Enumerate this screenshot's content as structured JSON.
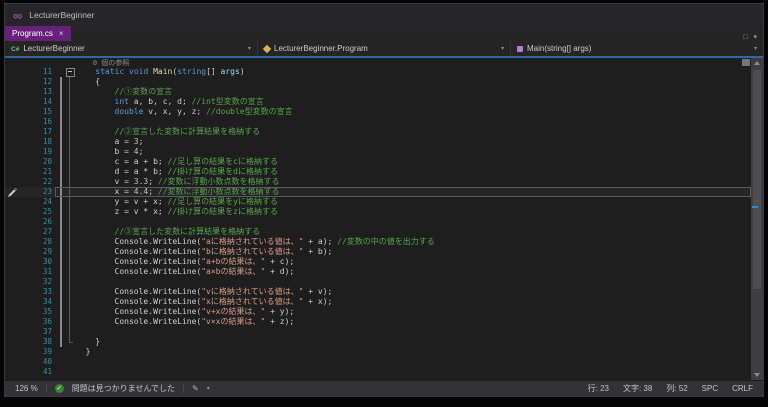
{
  "window": {
    "title": "LecturerBeginner"
  },
  "icons": {
    "logo": "∞",
    "close": "×",
    "chevron_down": "▾",
    "window_box": "□",
    "check": "✓",
    "pencil": "✎",
    "csharp": "C#"
  },
  "colors": {
    "titlebar_bg": "#26262A",
    "tabbar_bg": "#252526",
    "tab_accent": "#68217A",
    "nav_underline": "#2D68A8",
    "editor_bg": "#1E1E1E",
    "statusbar_bg": "#323237",
    "line_number": "#2B91AF",
    "keyword": "#569CD6",
    "comment": "#57A64A",
    "string": "#D69D85",
    "number": "#B5CEA8",
    "method": "#DCDCAA",
    "parameter": "#9CDCFE",
    "plain": "#CFCFCF",
    "codelens": "#8C8C8C",
    "change_bar": "#8A8A8A",
    "current_line_border": "#5A5A60"
  },
  "tab_bar": {
    "tabs": [
      {
        "label": "Program.cs"
      }
    ]
  },
  "navbar": {
    "project": "LecturerBeginner",
    "type": "LecturerBeginner.Program",
    "member": "Main(string[] args)"
  },
  "editor": {
    "lines": [
      {
        "lens": true,
        "tokens": [
          [
            "lens",
            "    0 個の参照"
          ]
        ]
      },
      {
        "num": 11,
        "fold": "box",
        "tokens": [
          [
            "kw",
            "    static"
          ],
          [
            "pl",
            " "
          ],
          [
            "kw",
            "void"
          ],
          [
            "pl",
            " "
          ],
          [
            "fn",
            "Main"
          ],
          [
            "pl",
            "("
          ],
          [
            "kw",
            "string"
          ],
          [
            "pl",
            "[] "
          ],
          [
            "pm",
            "args"
          ],
          [
            "pl",
            ")"
          ]
        ]
      },
      {
        "num": 12,
        "fold": "line",
        "chg": true,
        "tokens": [
          [
            "pl",
            "    {"
          ]
        ]
      },
      {
        "num": 13,
        "fold": "line",
        "chg": true,
        "tokens": [
          [
            "cm",
            "        //①変数の宣言"
          ]
        ]
      },
      {
        "num": 14,
        "fold": "line",
        "chg": true,
        "tokens": [
          [
            "kw",
            "        int"
          ],
          [
            "pl",
            " a, b, c, d; "
          ],
          [
            "cm",
            "//int型変数の宣言"
          ]
        ]
      },
      {
        "num": 15,
        "fold": "line",
        "chg": true,
        "tokens": [
          [
            "kw",
            "        double"
          ],
          [
            "pl",
            " v, x, y, z; "
          ],
          [
            "cm",
            "//double型変数の宣言"
          ]
        ]
      },
      {
        "num": 16,
        "fold": "line",
        "chg": true,
        "tokens": []
      },
      {
        "num": 17,
        "fold": "line",
        "chg": true,
        "tokens": [
          [
            "cm",
            "        //②宣言した変数に計算結果を格納する"
          ]
        ]
      },
      {
        "num": 18,
        "fold": "line",
        "chg": true,
        "tokens": [
          [
            "pl",
            "        a = "
          ],
          [
            "num",
            "3"
          ],
          [
            "pl",
            ";"
          ]
        ]
      },
      {
        "num": 19,
        "fold": "line",
        "chg": true,
        "tokens": [
          [
            "pl",
            "        b = "
          ],
          [
            "num",
            "4"
          ],
          [
            "pl",
            ";"
          ]
        ]
      },
      {
        "num": 20,
        "fold": "line",
        "chg": true,
        "tokens": [
          [
            "pl",
            "        c = a + b; "
          ],
          [
            "cm",
            "//足し算の結果をcに格納する"
          ]
        ]
      },
      {
        "num": 21,
        "fold": "line",
        "chg": true,
        "tokens": [
          [
            "pl",
            "        d = a * b; "
          ],
          [
            "cm",
            "//掛け算の結果をdに格納する"
          ]
        ]
      },
      {
        "num": 22,
        "fold": "line",
        "chg": true,
        "tokens": [
          [
            "pl",
            "        v = "
          ],
          [
            "num",
            "3.3"
          ],
          [
            "pl",
            "; "
          ],
          [
            "cm",
            "//変数に浮動小数点数を格納する"
          ]
        ]
      },
      {
        "num": 23,
        "fold": "line",
        "chg": true,
        "current": true,
        "pencil": true,
        "tokens": [
          [
            "pl",
            "        x = "
          ],
          [
            "num",
            "4.4"
          ],
          [
            "pl",
            "; "
          ],
          [
            "cm",
            "//変数に浮動小数点数を格納する"
          ]
        ]
      },
      {
        "num": 24,
        "fold": "line",
        "chg": true,
        "tokens": [
          [
            "pl",
            "        y = v + x; "
          ],
          [
            "cm",
            "//足し算の結果をyに格納する"
          ]
        ]
      },
      {
        "num": 25,
        "fold": "line",
        "chg": true,
        "tokens": [
          [
            "pl",
            "        z = v * x; "
          ],
          [
            "cm",
            "//掛け算の結果をzに格納する"
          ]
        ]
      },
      {
        "num": 26,
        "fold": "line",
        "chg": true,
        "tokens": []
      },
      {
        "num": 27,
        "fold": "line",
        "chg": true,
        "tokens": [
          [
            "cm",
            "        //③宣言した変数に計算結果を格納する"
          ]
        ]
      },
      {
        "num": 28,
        "fold": "line",
        "chg": true,
        "tokens": [
          [
            "pl",
            "        Console.WriteLine("
          ],
          [
            "str",
            "\"aに格納されている値は、\""
          ],
          [
            "pl",
            " + a); "
          ],
          [
            "cm",
            "//変数の中の値を出力する"
          ]
        ]
      },
      {
        "num": 29,
        "fold": "line",
        "chg": true,
        "tokens": [
          [
            "pl",
            "        Console.WriteLine("
          ],
          [
            "str",
            "\"bに格納されている値は、\""
          ],
          [
            "pl",
            " + b);"
          ]
        ]
      },
      {
        "num": 30,
        "fold": "line",
        "chg": true,
        "tokens": [
          [
            "pl",
            "        Console.WriteLine("
          ],
          [
            "str",
            "\"a+bの結果は、\""
          ],
          [
            "pl",
            " + c);"
          ]
        ]
      },
      {
        "num": 31,
        "fold": "line",
        "chg": true,
        "tokens": [
          [
            "pl",
            "        Console.WriteLine("
          ],
          [
            "str",
            "\"a×bの結果は、\""
          ],
          [
            "pl",
            " + d);"
          ]
        ]
      },
      {
        "num": 32,
        "fold": "line",
        "chg": true,
        "tokens": []
      },
      {
        "num": 33,
        "fold": "line",
        "chg": true,
        "tokens": [
          [
            "pl",
            "        Console.WriteLine("
          ],
          [
            "str",
            "\"vに格納されている値は、\""
          ],
          [
            "pl",
            " + v);"
          ]
        ]
      },
      {
        "num": 34,
        "fold": "line",
        "chg": true,
        "tokens": [
          [
            "pl",
            "        Console.WriteLine("
          ],
          [
            "str",
            "\"xに格納されている値は、\""
          ],
          [
            "pl",
            " + x);"
          ]
        ]
      },
      {
        "num": 35,
        "fold": "line",
        "chg": true,
        "tokens": [
          [
            "pl",
            "        Console.WriteLine("
          ],
          [
            "str",
            "\"v+xの結果は、\""
          ],
          [
            "pl",
            " + y);"
          ]
        ]
      },
      {
        "num": 36,
        "fold": "line",
        "chg": true,
        "tokens": [
          [
            "pl",
            "        Console.WriteLine("
          ],
          [
            "str",
            "\"v×xの結果は、\""
          ],
          [
            "pl",
            " + z);"
          ]
        ]
      },
      {
        "num": 37,
        "fold": "line",
        "chg": true,
        "tokens": []
      },
      {
        "num": 38,
        "fold": "end",
        "chg": true,
        "tokens": [
          [
            "pl",
            "    }"
          ]
        ]
      },
      {
        "num": 39,
        "tokens": [
          [
            "pl",
            "  }"
          ]
        ]
      },
      {
        "num": 40,
        "tokens": []
      },
      {
        "num": 41,
        "tokens": []
      }
    ]
  },
  "statusbar": {
    "zoom": "126 %",
    "message": "問題は見つかりませんでした",
    "pos_line": "行: 23",
    "pos_char": "文字: 38",
    "pos_col": "列: 52",
    "indent_mode": "SPC",
    "line_ending": "CRLF"
  }
}
